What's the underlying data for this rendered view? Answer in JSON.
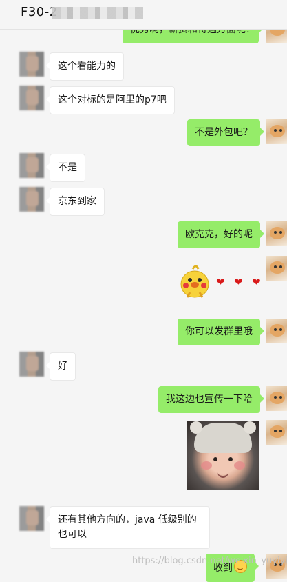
{
  "header": {
    "title": "F30-2"
  },
  "messages": {
    "m0": "优秀啊，薪资和待遇方面呢？",
    "m1": "这个看能力的",
    "m2": "这个对标的是阿里的p7吧",
    "m3": "不是外包吧？",
    "m4": "不是",
    "m5": "京东到家",
    "m6": "欧克克，好的呢",
    "m7": "你可以发群里哦",
    "m8": "好",
    "m9": "我这边也宣传一下哈",
    "m10": "还有其他方向的，java 低级别的也可以",
    "m11": "收到"
  },
  "watermark": "https://blog.csdn.net/weixin_yuyiyin",
  "colors": {
    "sent_bubble": "#95ec69",
    "received_bubble": "#ffffff",
    "background": "#f5f5f5"
  },
  "stickers": {
    "chick_sticker": "chick-with-hearts-sticker",
    "photo": "baby-photo"
  }
}
